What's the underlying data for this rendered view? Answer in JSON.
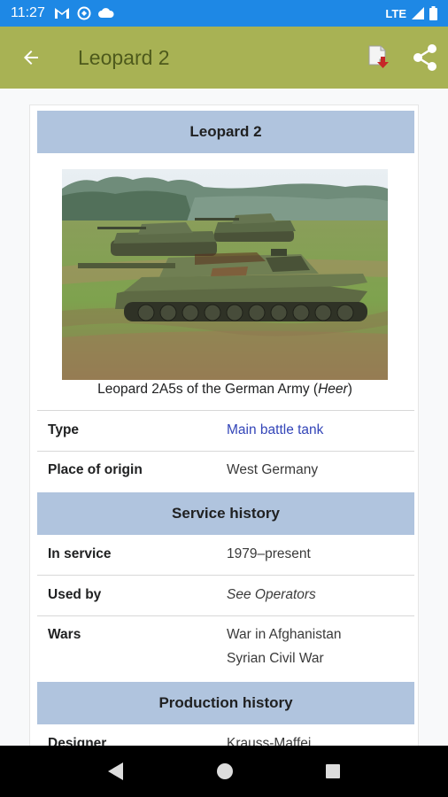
{
  "status_bar": {
    "time": "11:27",
    "network": "LTE"
  },
  "app_bar": {
    "title": "Leopard 2"
  },
  "infobox": {
    "title": "Leopard 2",
    "image_caption_prefix": "Leopard 2A5s of the German Army (",
    "image_caption_italic": "Heer",
    "image_caption_suffix": ")",
    "rows": [
      {
        "label": "Type",
        "value": "Main battle tank"
      },
      {
        "label": "Place of origin",
        "value": "West Germany"
      }
    ],
    "service_history_header": "Service history",
    "service_rows": [
      {
        "label": "In service",
        "value": "1979–present"
      },
      {
        "label": "Used by",
        "value_prefix": "See ",
        "value_italic": "Operators"
      },
      {
        "label": "Wars",
        "values": [
          "War in Afghanistan",
          "Syrian Civil War"
        ]
      }
    ],
    "production_history_header": "Production history",
    "production_rows": [
      {
        "label": "Designer",
        "value": "Krauss-Maffei"
      }
    ]
  },
  "colors": {
    "status_bar": "#1e88e5",
    "app_bar": "#a8b254",
    "header_bg": "#b0c4de",
    "link": "#3345b8"
  }
}
